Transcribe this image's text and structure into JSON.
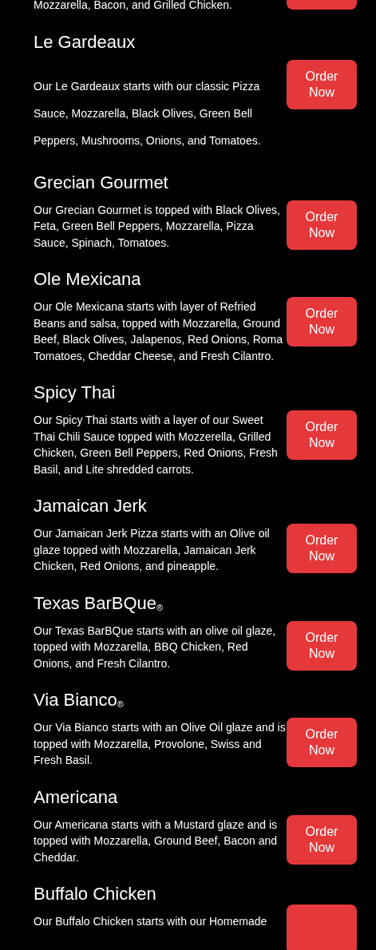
{
  "items": [
    {
      "description": "Mozzarella, Bacon, and Grilled Chicken."
    },
    {
      "title": "Le Gardeaux",
      "kind": "loose",
      "description": "Our Le Gardeaux starts with our classic Pizza Sauce, Mozzarella, Black Olives, Green Bell Peppers, Mushrooms, Onions, and Tomatoes.",
      "button": {
        "label": "Order Now"
      }
    },
    {
      "title": "Grecian Gourmet",
      "kind": "normal",
      "description": "Our Grecian Gourmet is topped with Black Olives, Feta, Green Bell Peppers, Mozzarella, Pizza Sauce, Spinach, Tomatoes.",
      "button": {
        "label": "Order Now"
      }
    },
    {
      "title": "Ole Mexicana",
      "kind": "normal",
      "description": "Our Ole Mexicana starts with layer of Refried Beans and salsa, topped with Mozzarella, Ground Beef, Black Olives, Jalapenos, Red Onions, Roma Tomatoes, Cheddar Cheese, and Fresh Cilantro.",
      "button": {
        "label": "Order Now"
      }
    },
    {
      "title": "Spicy Thai",
      "kind": "normal",
      "description": "Our Spicy Thai starts with a layer of our Sweet Thai Chili Sauce topped with Mozzerella, Grilled Chicken, Green Bell Peppers, Red Onions, Fresh Basil, and Lite shredded carrots.",
      "button": {
        "label": "Order Now"
      }
    },
    {
      "title": "Jamaican Jerk",
      "kind": "normal",
      "description": "Our Jamaican Jerk Pizza starts with an Olive oil glaze topped with Mozzarella, Jamaican Jerk Chicken, Red Onions, and pineapple.",
      "button": {
        "label": "Order Now"
      }
    },
    {
      "title": "Texas BarBQue$_{®}$",
      "kind": "normal",
      "description": "Our Texas BarBQue starts with an olive oil glaze, topped with Mozzarella, BBQ Chicken, Red Onions, and Fresh Cilantro.",
      "button": {
        "label": "Order Now"
      }
    },
    {
      "title": "Via Bianco$_{®}$",
      "kind": "normal",
      "description": "Our Via Bianco starts with an Olive Oil glaze and is topped with Mozzarella, Provolone, Swiss and Fresh Basil.",
      "button": {
        "label": "Order Now"
      }
    },
    {
      "title": "Americana",
      "kind": "normal",
      "description": "Our Americana starts with a Mustard glaze and is topped with Mozzarella, Ground Beef, Bacon and Cheddar.",
      "button": {
        "label": "Order Now"
      }
    },
    {
      "title": "Buffalo Chicken",
      "kind": "normal",
      "description": "Our Buffalo Chicken starts with our Homemade"
    }
  ]
}
